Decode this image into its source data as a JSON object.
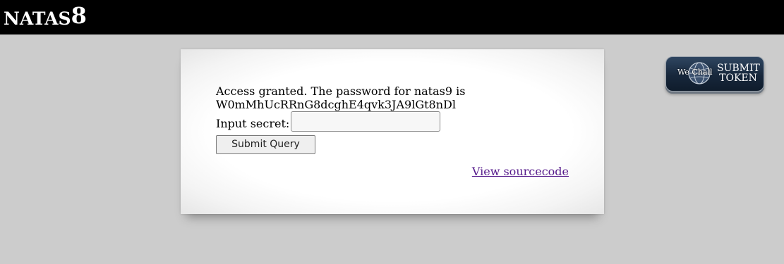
{
  "header": {
    "title_text": "NATAS",
    "title_number": "8",
    "background": "#000000",
    "text_color": "#ffffff"
  },
  "content": {
    "message_line1": "Access granted. The password for natas9 is",
    "message_line2": "W0mMhUcRRnG8dcghE4qvk3JA9lGt8nDl",
    "secret_label": "Input secret:",
    "secret_value": "",
    "submit_label": "Submit Query",
    "source_link": "View sourcecode",
    "link_color": "#551a8b"
  },
  "wechall": {
    "brand": "We Chall",
    "token_line1": "SUBMIT",
    "token_line2": "TOKEN",
    "icon": "globe-icon"
  },
  "page": {
    "background": "#cccccc"
  }
}
